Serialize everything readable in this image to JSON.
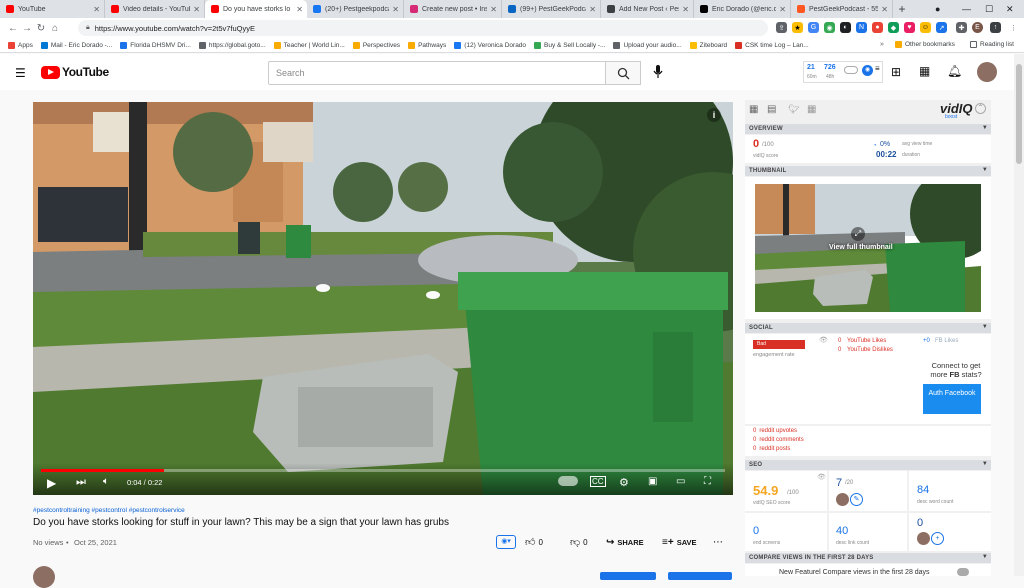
{
  "browser": {
    "tabs": [
      {
        "title": "YouTube",
        "color": "#ff0000",
        "active": false
      },
      {
        "title": "Video details - YouTub",
        "color": "#ff0000",
        "active": false
      },
      {
        "title": "Do you have storks lo",
        "color": "#ff0000",
        "active": true
      },
      {
        "title": "(20+) Pestgeekpodcas",
        "color": "#1877f2",
        "active": false
      },
      {
        "title": "Create new post • Insta",
        "color": "#d62976",
        "active": false
      },
      {
        "title": "(99+) PestGeekPodca",
        "color": "#0a66c2",
        "active": false
      },
      {
        "title": "Add New Post ‹ Pest G",
        "color": "#3c4043",
        "active": false
      },
      {
        "title": "Eric Dorado (@eric.do",
        "color": "#000000",
        "active": false
      },
      {
        "title": "PestGeekPodcast - 55",
        "color": "#ff5722",
        "active": false
      }
    ],
    "url": "https://www.youtube.com/watch?v=2t5v7fuQyyE",
    "bookmarks": [
      {
        "label": "Apps",
        "color": "#ea4335"
      },
      {
        "label": "Mail - Eric Dorado -...",
        "color": "#0078d4"
      },
      {
        "label": "Florida DHSMV Dri...",
        "color": "#1a73e8"
      },
      {
        "label": "https://global.goto...",
        "color": "#5f6368"
      },
      {
        "label": "Teacher | World Lin...",
        "color": "#f9ab00"
      },
      {
        "label": "Perspectives",
        "color": "#f9ab00"
      },
      {
        "label": "Pathways",
        "color": "#f9ab00"
      },
      {
        "label": "(12) Veronica Dorado",
        "color": "#1877f2"
      },
      {
        "label": "Buy & Sell Locally -...",
        "color": "#34a853"
      },
      {
        "label": "Upload your audio...",
        "color": "#5f6368"
      },
      {
        "label": "Ziteboard",
        "color": "#fbbc04"
      },
      {
        "label": "CSK time Log – Lan...",
        "color": "#d93025"
      }
    ],
    "other_bookmarks": "Other bookmarks",
    "reading_list": "Reading list"
  },
  "youtube": {
    "logo": "YouTube",
    "search_placeholder": "Search",
    "header_stats": {
      "a": "21",
      "a_sub": "60m",
      "b": "726",
      "b_sub": "48h"
    }
  },
  "video": {
    "time": "0:04 / 0:22",
    "progress": 0.18,
    "hashtags": "#pestcontroltraining #pestcontrol #pestcontrolservice",
    "title": "Do you have storks looking for stuff in your lawn? This may be a sign that your lawn has grubs",
    "views": "No views",
    "date": "Oct 25, 2021",
    "likes": "0",
    "dislikes": "0",
    "share": "SHARE",
    "save": "SAVE",
    "thumb_label": "View full thumbnail"
  },
  "vidiq": {
    "brand": "vidIQ",
    "brand_sub": "boost",
    "overview": {
      "header": "OVERVIEW",
      "score": "0",
      "score_max": "/100",
      "score_label": "vidIQ score",
      "pct": "0%",
      "pct_label": "avg view time",
      "duration": "00:22",
      "duration_label": "duration"
    },
    "thumbnail_header": "THUMBNAIL",
    "social": {
      "header": "SOCIAL",
      "badge": "Bad",
      "engagement_label": "engagement rate",
      "yt_likes": "0",
      "yt_likes_label": "YouTube Likes",
      "yt_dislikes": "0",
      "yt_dislikes_label": "YouTube Dislikes",
      "fb_likes": "0",
      "fb_likes_label": "FB Likes",
      "fb_prompt_1": "Connect to get",
      "fb_prompt_2": "more",
      "fb_prompt_bold": "FB",
      "fb_prompt_3": "stats?",
      "fb_button": "Auth Facebook",
      "reddit": [
        {
          "value": "0",
          "label": "reddit upvotes"
        },
        {
          "value": "0",
          "label": "reddit comments"
        },
        {
          "value": "0",
          "label": "reddit posts"
        }
      ]
    },
    "seo": {
      "header": "SEO",
      "score": "54.9",
      "score_max": "/100",
      "score_label": "vidIQ SEO score",
      "tags": "7",
      "tags_max": "/20",
      "desc_words": "84",
      "desc_words_label": "desc word count",
      "end_screens": "0",
      "end_screens_label": "end screens",
      "desc_links": "40",
      "desc_links_label": "desc link count",
      "cards": "0"
    },
    "compare": {
      "header": "COMPARE VIEWS IN THE FIRST 28 DAYS",
      "teaser": "New Featurel Compare views in the first 28 days"
    }
  }
}
